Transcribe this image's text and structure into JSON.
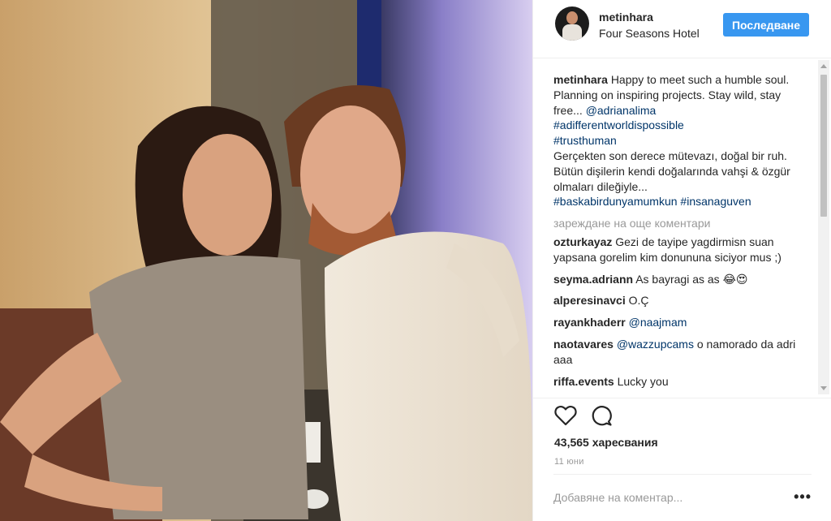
{
  "post": {
    "author": {
      "username": "metinhara",
      "location": "Four Seasons Hotel"
    },
    "follow_label": "Последване",
    "caption": {
      "username": "metinhara",
      "text": "Happy to meet such a humble soul. Planning on inspiring projects. Stay wild, stay free...",
      "mention": "@adrianalima",
      "hashtags": [
        "#adifferentworldispossible",
        "#trusthuman"
      ],
      "translation": "Gerçekten son derece mütevazı, doğal bir ruh. Bütün dişilerin kendi doğalarında vahşi & özgür olmaları dileğiyle...",
      "translation_hashtags": [
        "#baskabirdunyamumkun",
        "#insanaguven"
      ]
    },
    "load_more_label": "зареждане на още коментари",
    "comments": [
      {
        "username": "ozturkayaz",
        "text": "Gezi de tayipe yagdirmisn suan yapsana gorelim kim donununa siciyor mus ;)"
      },
      {
        "username": "seyma.adriann",
        "text": "As bayragi as as 😂😍"
      },
      {
        "username": "alperesinavci",
        "text": "O.Ç"
      },
      {
        "username": "rayankhaderr",
        "mention": "@naajmam",
        "text": ""
      },
      {
        "username": "naotavares",
        "mention": "@wazzupcams",
        "text": "o namorado da adri aaa"
      },
      {
        "username": "riffa.events",
        "text": "Lucky you"
      }
    ],
    "likes_label": "43,565 харесвания",
    "date_label": "11 юни",
    "add_comment_placeholder": "Добавяне на коментар...",
    "more_label": "•••"
  },
  "icons": {
    "like": "heart-icon",
    "comment": "comment-icon",
    "more": "more-icon"
  },
  "colors": {
    "follow_button": "#3897f0",
    "link": "#003569",
    "muted": "#999999"
  }
}
